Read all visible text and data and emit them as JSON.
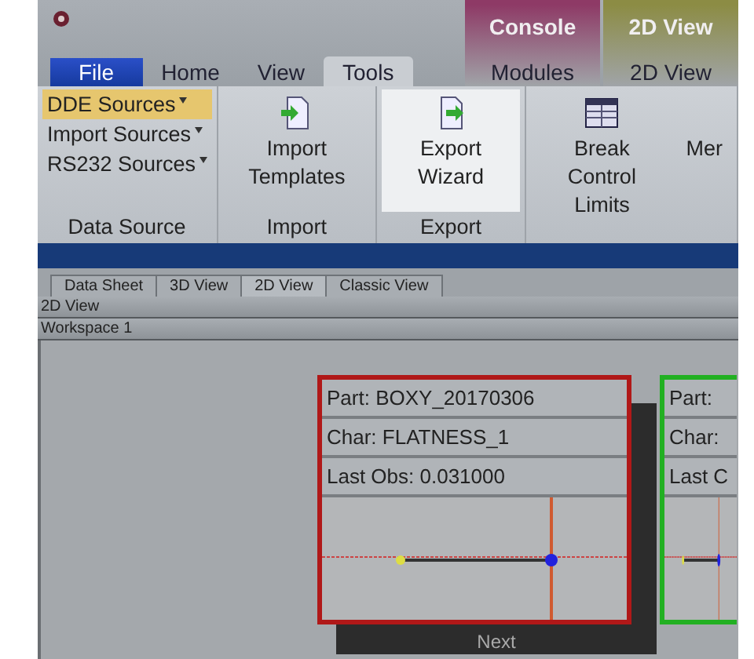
{
  "ribbon_tabs": [
    {
      "label": "File",
      "kind": "file",
      "selected": false
    },
    {
      "label": "Home",
      "kind": "tab",
      "selected": false
    },
    {
      "label": "View",
      "kind": "tab",
      "selected": false
    },
    {
      "label": "Tools",
      "kind": "tab",
      "selected": true
    }
  ],
  "context_groups": [
    {
      "label": "Console",
      "color": "#8e3a66",
      "tabs": [
        {
          "label": "Modules",
          "selected": false
        }
      ]
    },
    {
      "label": "2D View",
      "color": "#8c8c44",
      "tabs": [
        {
          "label": "2D View",
          "selected": false
        }
      ]
    }
  ],
  "ribbon_groups": [
    {
      "label": "Data Source",
      "kind": "small",
      "items": [
        {
          "label": "DDE Sources",
          "highlighted": true
        },
        {
          "label": "Import Sources",
          "highlighted": false
        },
        {
          "label": "RS232 Sources",
          "highlighted": false
        }
      ]
    },
    {
      "label": "Import",
      "kind": "large",
      "items": [
        {
          "label": "Import Templates",
          "kind": "import",
          "highlighted": false
        }
      ]
    },
    {
      "label": "Export",
      "kind": "large",
      "items": [
        {
          "label": "Export Wizard",
          "kind": "export",
          "highlighted": true
        }
      ]
    },
    {
      "kind": "large",
      "items": [
        {
          "label": "Break Control Limits",
          "kind": "table",
          "highlighted": false
        },
        {
          "label": "Mer",
          "highlighted": false
        }
      ]
    }
  ],
  "document_tabs": [
    {
      "label": "Data Sheet",
      "selected": false
    },
    {
      "label": "3D View",
      "selected": false
    },
    {
      "label": "2D View",
      "selected": true
    },
    {
      "label": "Classic View",
      "selected": false
    }
  ],
  "view_title": "2D View",
  "workspace_title": "Workspace 1",
  "cards": [
    {
      "color": "#b01818",
      "rows": [
        "Part: BOXY_20170306",
        "Char: FLATNESS_1",
        "Last Obs: 0.031000"
      ],
      "footer": "Next"
    },
    {
      "color": "#22b022",
      "rows": [
        "Part:",
        "Char:",
        "Last C"
      ]
    }
  ]
}
